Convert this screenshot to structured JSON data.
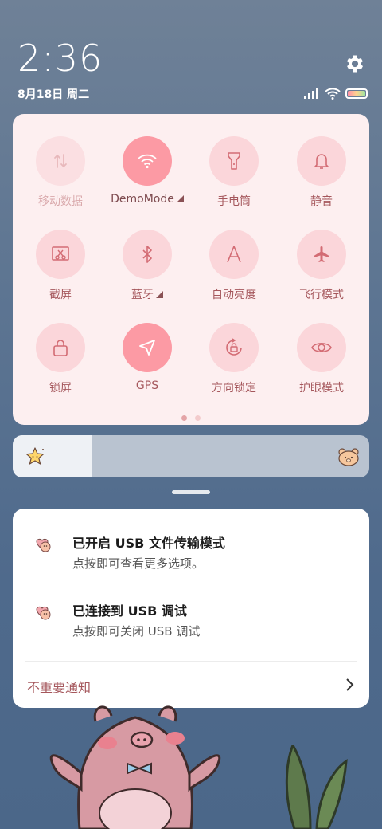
{
  "header": {
    "time": "2:36",
    "date": "8月18日 周二"
  },
  "controls": {
    "tiles": [
      {
        "label": "移动数据",
        "icon": "mobile-data-icon",
        "state": "disabled"
      },
      {
        "label": "DemoMode",
        "icon": "wifi-icon",
        "state": "on",
        "expandable": true
      },
      {
        "label": "手电筒",
        "icon": "flashlight-icon",
        "state": "off"
      },
      {
        "label": "静音",
        "icon": "bell-icon",
        "state": "off"
      },
      {
        "label": "截屏",
        "icon": "screenshot-icon",
        "state": "off"
      },
      {
        "label": "蓝牙",
        "icon": "bluetooth-icon",
        "state": "off",
        "expandable": true
      },
      {
        "label": "自动亮度",
        "icon": "auto-brightness-icon",
        "state": "off"
      },
      {
        "label": "飞行模式",
        "icon": "airplane-icon",
        "state": "off"
      },
      {
        "label": "锁屏",
        "icon": "lock-icon",
        "state": "off"
      },
      {
        "label": "GPS",
        "icon": "location-arrow-icon",
        "state": "on"
      },
      {
        "label": "方向锁定",
        "icon": "rotation-lock-icon",
        "state": "off"
      },
      {
        "label": "护眼模式",
        "icon": "eye-icon",
        "state": "off"
      }
    ],
    "page": 1,
    "pages": 2
  },
  "brightness": {
    "level": 0.22
  },
  "notifications": {
    "items": [
      {
        "title": "已开启 USB 文件传输模式",
        "subtitle": "点按即可查看更多选项。"
      },
      {
        "title": "已连接到 USB 调试",
        "subtitle": "点按即可关闭 USB 调试"
      }
    ],
    "unimportant_label": "不重要通知"
  },
  "colors": {
    "panel_bg": "#fdeff0",
    "tile_off": "#fbd6da",
    "tile_on": "#fc9aa4",
    "label": "#a5575c",
    "wallpaper": "#5d7592"
  }
}
